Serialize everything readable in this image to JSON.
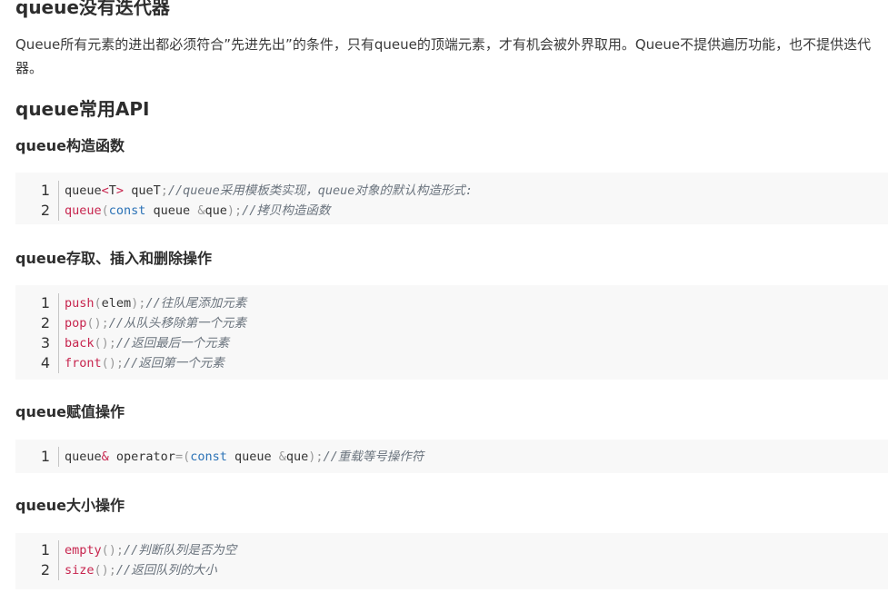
{
  "heading_top": "queue没有迭代器",
  "paragraph": "Queue所有元素的进出都必须符合”先进先出”的条件，只有queue的顶端元素，才有机会被外界取用。Queue不提供遍历功能，也不提供迭代器。",
  "heading_api": "queue常用API",
  "sections": [
    {
      "title": "queue构造函数",
      "lines": [
        {
          "num": "1",
          "a": "queue",
          "b": "<",
          "c": "T",
          "d": ">",
          "e": " queT",
          "f": ";",
          "g": "//queue采用模板类实现，queue对象的默认构造形式:"
        },
        {
          "num": "2",
          "a": "queue",
          "b": "(",
          "c": "const",
          "d": " queue ",
          "e": "&",
          "f": "que",
          "g": ");",
          "h": "//拷贝构造函数"
        }
      ]
    },
    {
      "title": "queue存取、插入和删除操作",
      "lines": [
        {
          "num": "1",
          "fn": "push",
          "open": "(",
          "arg": "elem",
          "close": ");",
          "comment": "//往队尾添加元素"
        },
        {
          "num": "2",
          "fn": "pop",
          "open": "();",
          "arg": "",
          "close": "",
          "comment": "//从队头移除第一个元素"
        },
        {
          "num": "3",
          "fn": "back",
          "open": "();",
          "arg": "",
          "close": "",
          "comment": "//返回最后一个元素"
        },
        {
          "num": "4",
          "fn": "front",
          "open": "();",
          "arg": "",
          "close": "",
          "comment": "//返回第一个元素"
        }
      ]
    },
    {
      "title": "queue赋值操作",
      "lines": [
        {
          "num": "1",
          "a": "queue",
          "b": "&",
          "c": " operator",
          "d": "=(",
          "e": "const",
          "f": " queue ",
          "g": "&",
          "h": "que",
          "i": ");",
          "j": "//重载等号操作符"
        }
      ]
    },
    {
      "title": "queue大小操作",
      "lines": [
        {
          "num": "1",
          "fn": "empty",
          "open": "();",
          "comment": "//判断队列是否为空"
        },
        {
          "num": "2",
          "fn": "size",
          "open": "();",
          "comment": "//返回队列的大小"
        }
      ]
    }
  ]
}
